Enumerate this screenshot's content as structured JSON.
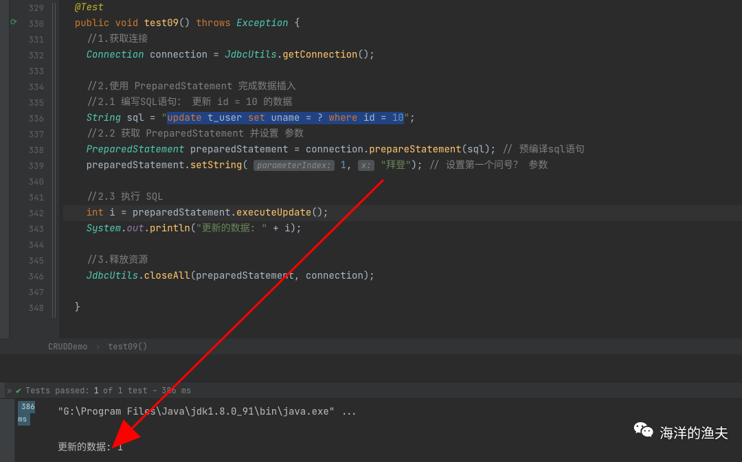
{
  "gutter": {
    "start": 329,
    "end": 348
  },
  "code": {
    "l329_anno": "@Test",
    "l330_seg": {
      "public": "public",
      "void": "void",
      "name": "test09",
      "throws": "throws",
      "exc": "Exception"
    },
    "l331_cmt": "//1.获取连接",
    "l332": {
      "type": "Connection",
      "var": "connection",
      "cls": "JdbcUtils",
      "call": "getConnection"
    },
    "l334_cmt": "//2.使用 PreparedStatement 完成数据插入",
    "l335_cmt": "//2.1 编写SQL语句： 更新 id = 10 的数据",
    "l336": {
      "type": "String",
      "var": "sql",
      "open": "\"",
      "sql_update": "update",
      "sql_tbl": " t_user ",
      "sql_set": "set",
      "sql_col": " uname = ? ",
      "sql_where": "where",
      "sql_cond": " id = ",
      "sql_num": "10",
      "close": "\""
    },
    "l337_cmt": "//2.2 获取 PreparedStatement 并设置 参数",
    "l338": {
      "type": "PreparedStatement",
      "var": "preparedStatement",
      "rhs": "connection",
      "call": "prepareStatement",
      "arg": "sql",
      "cmt": "// 预编译sql语句"
    },
    "l339": {
      "lhs": "preparedStatement",
      "call": "setString",
      "hint1": "parameterIndex:",
      "arg1": "1",
      "hint2": "x:",
      "arg2": "\"拜登\"",
      "cmt": "// 设置第一个问号？ 参数"
    },
    "l341_cmt": "//2.3 执行 SQL",
    "l342": {
      "type": "int",
      "var": "i",
      "rhs": "preparedStatement",
      "call": "executeUpdate"
    },
    "l343": {
      "cls": "System",
      "field": "out",
      "call": "println",
      "str": "\"更新的数据: \"",
      "plus": " + ",
      "var": "i"
    },
    "l345_cmt": "//3.释放资源",
    "l346": {
      "cls": "JdbcUtils",
      "call": "closeAll",
      "a1": "preparedStatement",
      "a2": "connection"
    }
  },
  "breadcrumb": {
    "cls": "CRUDDemo",
    "method": "test09()"
  },
  "testbar": {
    "prefix": "Tests passed:",
    "count": "1",
    "mid": "of 1 test –",
    "time": "386 ms"
  },
  "console": {
    "tag": "386 ms",
    "line1": "\"G:\\Program Files\\Java\\jdk1.8.0_91\\bin\\java.exe\" ...",
    "line2": "更新的数据: 1"
  },
  "watermark": {
    "text": "海洋的渔夫"
  }
}
